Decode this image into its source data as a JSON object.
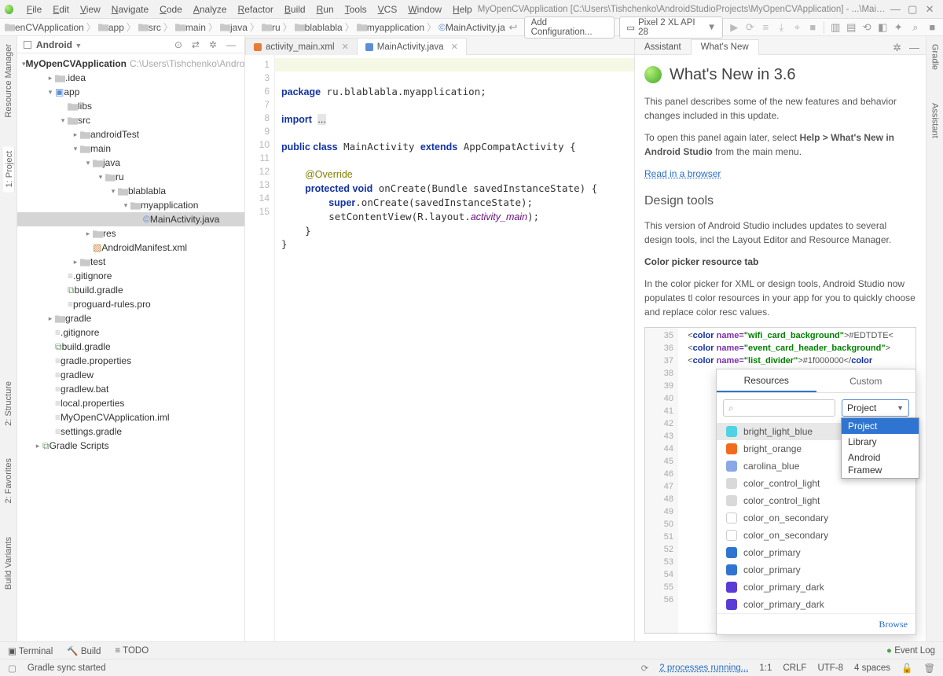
{
  "menubar": {
    "items": [
      "File",
      "Edit",
      "View",
      "Navigate",
      "Code",
      "Analyze",
      "Refactor",
      "Build",
      "Run",
      "Tools",
      "VCS",
      "Window",
      "Help"
    ],
    "title": "MyOpenCVApplication [C:\\Users\\Tishchenko\\AndroidStudioProjects\\MyOpenCVApplication] - ...\\MainActivity.java"
  },
  "breadcrumbs": [
    "enCVApplication",
    "app",
    "src",
    "main",
    "java",
    "ru",
    "blablabla",
    "myapplication",
    "MainActivity.java"
  ],
  "run_config": {
    "add": "Add Configuration...",
    "device": "Pixel 2 XL API 28"
  },
  "left_tool_tabs": [
    "Resource Manager",
    "1: Project",
    "2: Structure",
    "2: Favorites",
    "Build Variants"
  ],
  "right_tool_tabs": [
    "Gradle",
    "Assistant"
  ],
  "project_panel": {
    "title": "Android",
    "root": {
      "label": "MyOpenCVApplication",
      "hint": "C:\\Users\\Tishchenko\\AndroidS"
    },
    "nodes": [
      {
        "depth": 1,
        "chev": "▸",
        "ic": "folder",
        "label": ".idea"
      },
      {
        "depth": 1,
        "chev": "▾",
        "ic": "mod",
        "label": "app"
      },
      {
        "depth": 2,
        "chev": "",
        "ic": "folder",
        "label": "libs"
      },
      {
        "depth": 2,
        "chev": "▾",
        "ic": "folder",
        "label": "src"
      },
      {
        "depth": 3,
        "chev": "▸",
        "ic": "folder",
        "label": "androidTest"
      },
      {
        "depth": 3,
        "chev": "▾",
        "ic": "folder",
        "label": "main"
      },
      {
        "depth": 4,
        "chev": "▾",
        "ic": "folder",
        "label": "java"
      },
      {
        "depth": 5,
        "chev": "▾",
        "ic": "folder",
        "label": "ru"
      },
      {
        "depth": 6,
        "chev": "▾",
        "ic": "folder",
        "label": "blablabla"
      },
      {
        "depth": 7,
        "chev": "▾",
        "ic": "folder",
        "label": "myapplication"
      },
      {
        "depth": 8,
        "chev": "",
        "ic": "javaf",
        "label": "MainActivity.java",
        "selected": true
      },
      {
        "depth": 4,
        "chev": "▸",
        "ic": "folder",
        "label": "res"
      },
      {
        "depth": 4,
        "chev": "",
        "ic": "xml",
        "label": "AndroidManifest.xml"
      },
      {
        "depth": 3,
        "chev": "▸",
        "ic": "folder",
        "label": "test"
      },
      {
        "depth": 2,
        "chev": "",
        "ic": "file",
        "label": ".gitignore"
      },
      {
        "depth": 2,
        "chev": "",
        "ic": "gradle",
        "label": "build.gradle"
      },
      {
        "depth": 2,
        "chev": "",
        "ic": "file",
        "label": "proguard-rules.pro"
      },
      {
        "depth": 1,
        "chev": "▸",
        "ic": "folder",
        "label": "gradle"
      },
      {
        "depth": 1,
        "chev": "",
        "ic": "file",
        "label": ".gitignore"
      },
      {
        "depth": 1,
        "chev": "",
        "ic": "gradle",
        "label": "build.gradle"
      },
      {
        "depth": 1,
        "chev": "",
        "ic": "file",
        "label": "gradle.properties"
      },
      {
        "depth": 1,
        "chev": "",
        "ic": "file",
        "label": "gradlew"
      },
      {
        "depth": 1,
        "chev": "",
        "ic": "file",
        "label": "gradlew.bat"
      },
      {
        "depth": 1,
        "chev": "",
        "ic": "file",
        "label": "local.properties"
      },
      {
        "depth": 1,
        "chev": "",
        "ic": "file",
        "label": "MyOpenCVApplication.iml"
      },
      {
        "depth": 1,
        "chev": "",
        "ic": "file",
        "label": "settings.gradle"
      },
      {
        "depth": 0,
        "chev": "▸",
        "ic": "gradle",
        "label": "Gradle Scripts"
      }
    ]
  },
  "editor": {
    "tabs": [
      {
        "kind": "xml",
        "label": "activity_main.xml"
      },
      {
        "kind": "java",
        "label": "MainActivity.java",
        "active": true
      }
    ],
    "line_numbers": [
      "1",
      "3",
      "6",
      "7",
      "8",
      "9",
      "10",
      "11",
      "12",
      "13",
      "14",
      "15"
    ]
  },
  "assistant": {
    "tabs": [
      "Assistant",
      "What's New"
    ],
    "heading": "What's New in 3.6",
    "p1": "This panel describes some of the new features and behavior changes included in this update.",
    "p2a": "To open this panel again later, select ",
    "p2b": "Help > What's New in Android Studio",
    "p2c": " from the main menu.",
    "link": "Read in a browser",
    "h2": "Design tools",
    "p3": "This version of Android Studio includes updates to several design tools, incl the Layout Editor and Resource Manager.",
    "h3": "Color picker resource tab",
    "p4": "In the color picker for XML or design tools, Android Studio now populates tl color resources in your app for you to quickly choose and replace color resc values."
  },
  "color_picker": {
    "gut_lines": [
      "35",
      "36",
      "37",
      "38",
      "39",
      "40",
      "41",
      "42",
      "43",
      "44",
      "45",
      "46",
      "47",
      "48",
      "49",
      "50",
      "51",
      "52",
      "53",
      "54",
      "55",
      "56"
    ],
    "tabs": [
      "Resources",
      "Custom"
    ],
    "search_icon": "⌕",
    "drop_value": "Project",
    "drop_menu": [
      "Project",
      "Library",
      "Android Framew"
    ],
    "items": [
      {
        "color": "#4fd2e3",
        "label": "bright_light_blue",
        "sel": true
      },
      {
        "color": "#f26a1b",
        "label": "bright_orange"
      },
      {
        "color": "#8aa8e6",
        "label": "carolina_blue"
      },
      {
        "color": "#d9d9d9",
        "label": "color_control_light"
      },
      {
        "color": "#d9d9d9",
        "label": "color_control_light"
      },
      {
        "color": "",
        "label": "color_on_secondary"
      },
      {
        "color": "",
        "label": "color_on_secondary"
      },
      {
        "color": "#2f74d0",
        "label": "color_primary"
      },
      {
        "color": "#2f74d0",
        "label": "color_primary"
      },
      {
        "color": "#5a3bd6",
        "label": "color_primary_dark"
      },
      {
        "color": "#5a3bd6",
        "label": "color_primary_dark"
      }
    ],
    "browse": "Browse"
  },
  "bottom": {
    "tabs": [
      "Terminal",
      "Build",
      "TODO"
    ],
    "event_log": "Event Log"
  },
  "status": {
    "msg": "Gradle sync started",
    "proc": "2 processes running...",
    "pos": "1:1",
    "le": "CRLF",
    "enc": "UTF-8",
    "indent": "4 spaces"
  }
}
